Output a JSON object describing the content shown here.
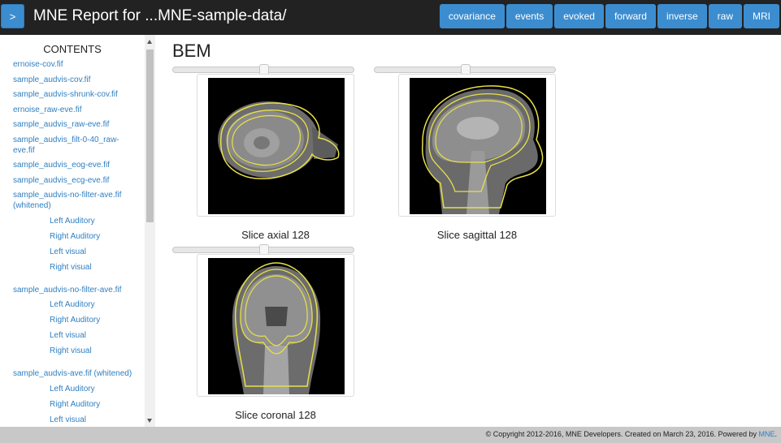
{
  "header": {
    "toggle_label": ">",
    "title": "MNE Report for ...MNE-sample-data/",
    "nav": [
      "covariance",
      "events",
      "evoked",
      "forward",
      "inverse",
      "raw",
      "MRI"
    ]
  },
  "sidebar": {
    "title": "CONTENTS",
    "items": [
      {
        "label": "ernoise-cov.fif"
      },
      {
        "label": "sample_audvis-cov.fif"
      },
      {
        "label": "sample_audvis-shrunk-cov.fif"
      },
      {
        "label": "ernoise_raw-eve.fif"
      },
      {
        "label": "sample_audvis_raw-eve.fif"
      },
      {
        "label": "sample_audvis_filt-0-40_raw-eve.fif"
      },
      {
        "label": "sample_audvis_eog-eve.fif"
      },
      {
        "label": "sample_audvis_ecg-eve.fif"
      },
      {
        "label": "sample_audvis-no-filter-ave.fif (whitened)"
      },
      {
        "label": "Left Auditory"
      },
      {
        "label": "Right Auditory"
      },
      {
        "label": "Left visual"
      },
      {
        "label": "Right visual"
      },
      {
        "label": "sample_audvis-no-filter-ave.fif"
      },
      {
        "label": "Left Auditory"
      },
      {
        "label": "Right Auditory"
      },
      {
        "label": "Left visual"
      },
      {
        "label": "Right visual"
      },
      {
        "label": "sample_audvis-ave.fif (whitened)"
      },
      {
        "label": "Left Auditory"
      },
      {
        "label": "Right Auditory"
      },
      {
        "label": "Left visual"
      }
    ]
  },
  "main": {
    "section_title": "BEM",
    "slices": [
      {
        "caption": "Slice axial 128",
        "slider_fraction": 0.5
      },
      {
        "caption": "Slice sagittal 128",
        "slider_fraction": 0.5
      },
      {
        "caption": "Slice coronal 128",
        "slider_fraction": 0.5
      }
    ]
  },
  "footer": {
    "text": "© Copyright 2012-2016, MNE Developers. Created on March 23, 2016. Powered by ",
    "link": "MNE",
    "end": "."
  },
  "colors": {
    "accent": "#3c8dcf",
    "topbar": "#222222",
    "link": "#2f7fc1",
    "bem_contour": "#e8e04a"
  }
}
